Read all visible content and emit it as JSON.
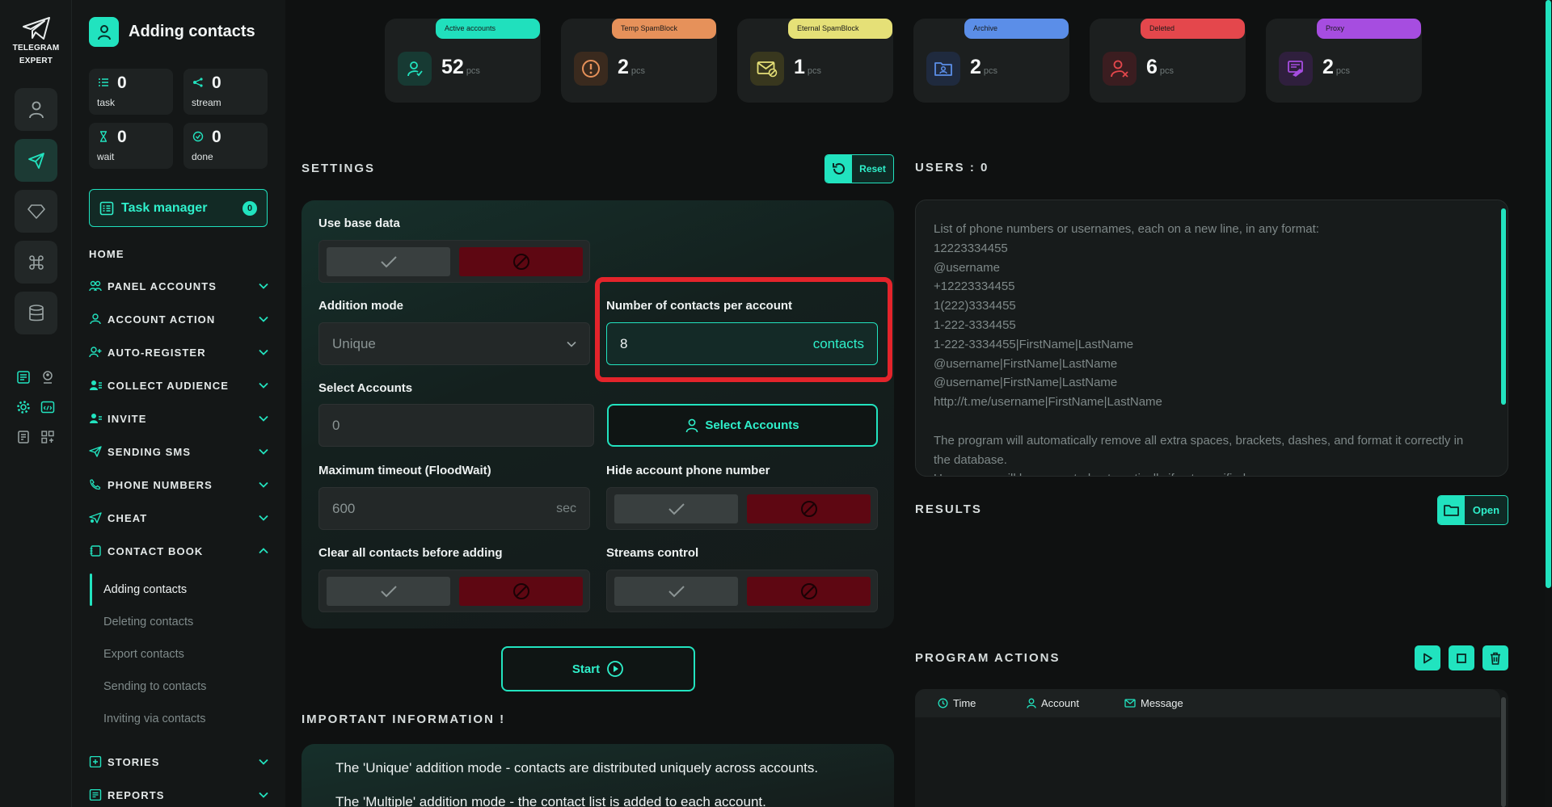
{
  "brand": {
    "line1": "TELEGRAM",
    "line2": "EXPERT"
  },
  "page": {
    "title": "Adding contacts"
  },
  "stats": [
    {
      "label": "task",
      "value": "0",
      "icon": "task-list-icon"
    },
    {
      "label": "stream",
      "value": "0",
      "icon": "stream-branch-icon"
    },
    {
      "label": "wait",
      "value": "0",
      "icon": "hourglass-icon"
    },
    {
      "label": "done",
      "value": "0",
      "icon": "check-circle-icon"
    }
  ],
  "task_manager": {
    "label": "Task manager",
    "count": "0"
  },
  "nav": {
    "home": "HOME",
    "items": [
      {
        "label": "PANEL ACCOUNTS"
      },
      {
        "label": "ACCOUNT ACTION"
      },
      {
        "label": "AUTO-REGISTER"
      },
      {
        "label": "COLLECT AUDIENCE"
      },
      {
        "label": "INVITE"
      },
      {
        "label": "SENDING SMS"
      },
      {
        "label": "PHONE NUMBERS"
      },
      {
        "label": "CHEAT"
      },
      {
        "label": "CONTACT BOOK"
      },
      {
        "label": "STORIES"
      },
      {
        "label": "REPORTS"
      }
    ],
    "contact_book_sub": [
      {
        "label": "Adding contacts"
      },
      {
        "label": "Deleting contacts"
      },
      {
        "label": "Export contacts"
      },
      {
        "label": "Sending to contacts"
      },
      {
        "label": "Inviting via contacts"
      }
    ]
  },
  "cards": [
    {
      "badge": "Active accounts",
      "value": "52",
      "unit": "pcs",
      "color": "#20e0bd",
      "icon": "user-check-icon"
    },
    {
      "badge": "Temp SpamBlock",
      "value": "2",
      "unit": "pcs",
      "color": "#e6915a",
      "icon": "warning-circle-icon"
    },
    {
      "badge": "Eternal SpamBlock",
      "value": "1",
      "unit": "pcs",
      "color": "#e5e077",
      "icon": "mail-block-icon"
    },
    {
      "badge": "Archive",
      "value": "2",
      "unit": "pcs",
      "color": "#5b8ee8",
      "icon": "archive-folder-icon"
    },
    {
      "badge": "Deleted",
      "value": "6",
      "unit": "pcs",
      "color": "#e4474c",
      "icon": "user-x-icon"
    },
    {
      "badge": "Proxy",
      "value": "2",
      "unit": "pcs",
      "color": "#a64de0",
      "icon": "proxy-server-icon"
    }
  ],
  "settings": {
    "title": "SETTINGS",
    "reset_label": "Reset",
    "use_base_data": "Use base data",
    "addition_mode": {
      "label": "Addition mode",
      "value": "Unique"
    },
    "contacts_per_account": {
      "label": "Number of contacts per account",
      "value": "8",
      "unit": "contacts"
    },
    "select_accounts": {
      "label": "Select Accounts",
      "value": "0",
      "button": "Select Accounts"
    },
    "max_timeout": {
      "label": "Maximum timeout (FloodWait)",
      "value": "600",
      "unit": "sec"
    },
    "hide_phone": "Hide account phone number",
    "clear_contacts": "Clear all contacts before adding",
    "streams_control": "Streams control",
    "start_label": "Start"
  },
  "important": {
    "title": "IMPORTANT INFORMATION !",
    "lines": [
      "The 'Unique' addition mode - contacts are distributed uniquely across accounts.",
      "The 'Multiple' addition mode - the contact list is added to each account."
    ]
  },
  "users": {
    "title": "USERS : 0",
    "placeholder": "List of phone numbers or usernames, each on a new line, in any format:\n12223334455\n@username\n+12223334455\n1(222)3334455\n1-222-3334455\n1-222-3334455|FirstName|LastName\n@username|FirstName|LastName\n@username|FirstName|LastName\nhttp://t.me/username|FirstName|LastName\n\nThe program will automatically remove all extra spaces, brackets, dashes, and format it correctly in the database.\nUsernames will be generated automatically if not specified."
  },
  "results": {
    "title": "RESULTS",
    "open_label": "Open"
  },
  "program_actions": {
    "title": "PROGRAM ACTIONS",
    "columns": [
      "Time",
      "Account",
      "Message"
    ]
  },
  "theme": {
    "accent": "#21e3bf",
    "danger": "#e3242b",
    "off_toggle": "#5e0712"
  }
}
